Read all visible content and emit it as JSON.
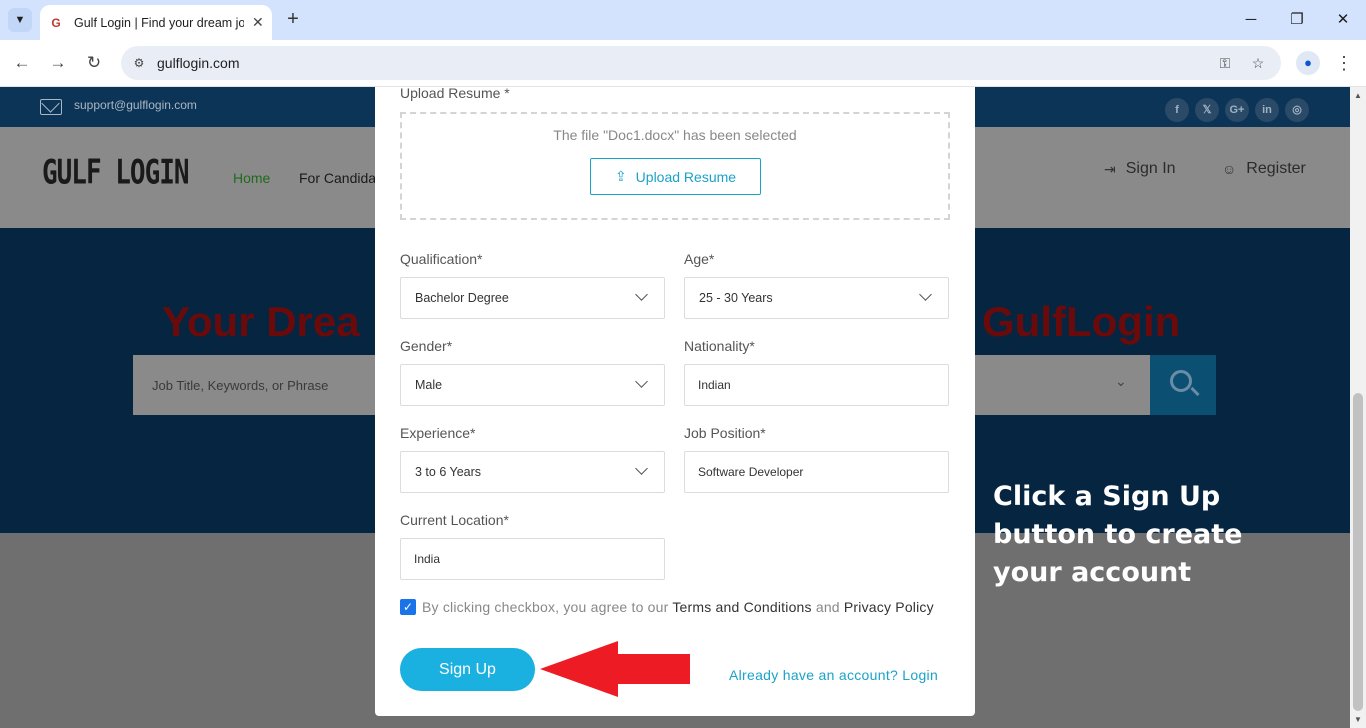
{
  "browser": {
    "tab_title": "Gulf Login | Find your dream jo",
    "url": "gulflogin.com",
    "tab_menu_icon": "chevron-down-icon",
    "new_tab": "+",
    "close": "✕",
    "minimize": "─",
    "restore": "❐"
  },
  "site": {
    "support_email": "support@gulflogin.com",
    "social": [
      "f",
      "𝕏",
      "G+",
      "in",
      "◎"
    ],
    "logo": "GULF LOGIN",
    "nav": {
      "home": "Home",
      "candidates": "For Candidat"
    },
    "signin": "Sign In",
    "register": "Register",
    "hero_left": "Your Drea",
    "hero_right": "GulfLogin",
    "search_placeholder": "Job Title, Keywords, or Phrase"
  },
  "form": {
    "upload_label": "Upload Resume *",
    "upload_note": "The file \"Doc1.docx\" has been selected",
    "upload_button": "Upload Resume",
    "qualification": {
      "label": "Qualification*",
      "value": "Bachelor Degree"
    },
    "age": {
      "label": "Age*",
      "value": "25 - 30 Years"
    },
    "gender": {
      "label": "Gender*",
      "value": "Male"
    },
    "nationality": {
      "label": "Nationality*",
      "value": "Indian"
    },
    "experience": {
      "label": "Experience*",
      "value": "3 to 6 Years"
    },
    "job_position": {
      "label": "Job Position*",
      "value": "Software Developer"
    },
    "current_location": {
      "label": "Current Location*",
      "value": "India"
    },
    "agree": {
      "prefix": "By clicking checkbox, you agree to our ",
      "terms": "Terms and Conditions",
      "and": " and ",
      "privacy": "Privacy Policy"
    },
    "signup_button": "Sign Up",
    "login_link": "Already have an account? Login"
  },
  "annotation": {
    "instruction": "Click a Sign Up button to create your account",
    "arrow_color": "#ed1c24"
  },
  "colors": {
    "accent": "#1ab0e0",
    "checkbox": "#1a73e8"
  }
}
